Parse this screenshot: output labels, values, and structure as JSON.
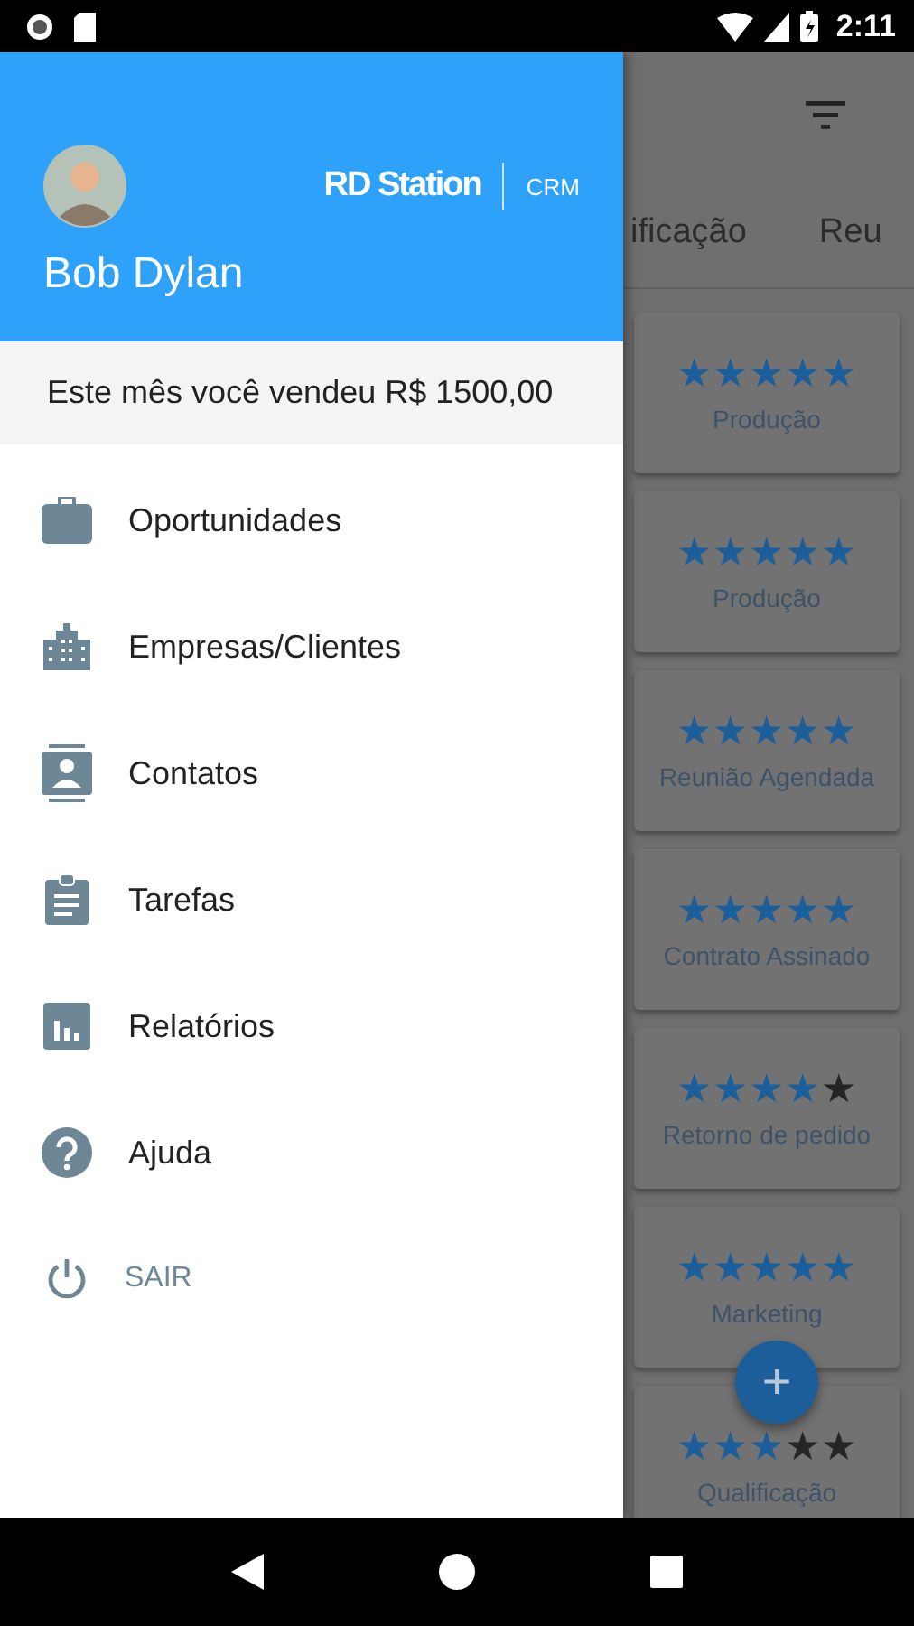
{
  "status_bar": {
    "time": "2:11"
  },
  "drawer": {
    "user_name": "Bob Dylan",
    "brand": "RD Station",
    "brand_suffix": "CRM",
    "sales_summary": "Este mês você vendeu R$ 1500,00",
    "items": [
      {
        "kind": "nav",
        "label": "Oportunidades"
      },
      {
        "kind": "nav",
        "label": "Empresas/Clientes"
      },
      {
        "kind": "nav",
        "label": "Contatos"
      },
      {
        "kind": "nav",
        "label": "Tarefas"
      },
      {
        "kind": "nav",
        "label": "Relatórios"
      },
      {
        "kind": "nav",
        "label": "Ajuda"
      },
      {
        "kind": "action",
        "label": "SAIR"
      }
    ]
  },
  "background": {
    "tabs": [
      {
        "label": "ificação"
      },
      {
        "label": "Reu"
      }
    ],
    "cards": [
      {
        "stars": 5,
        "stage": "Produção"
      },
      {
        "stars": 5,
        "stage": "Produção"
      },
      {
        "stars": 5,
        "stage": "Reunião Agendada"
      },
      {
        "stars": 5,
        "stage": "Contrato Assinado"
      },
      {
        "stars": 4,
        "stage": "Retorno de pedido"
      },
      {
        "stars": 5,
        "stage": "Marketing"
      },
      {
        "stars": 3,
        "stage": "Qualificação"
      }
    ],
    "fab": {
      "label": "+"
    }
  }
}
